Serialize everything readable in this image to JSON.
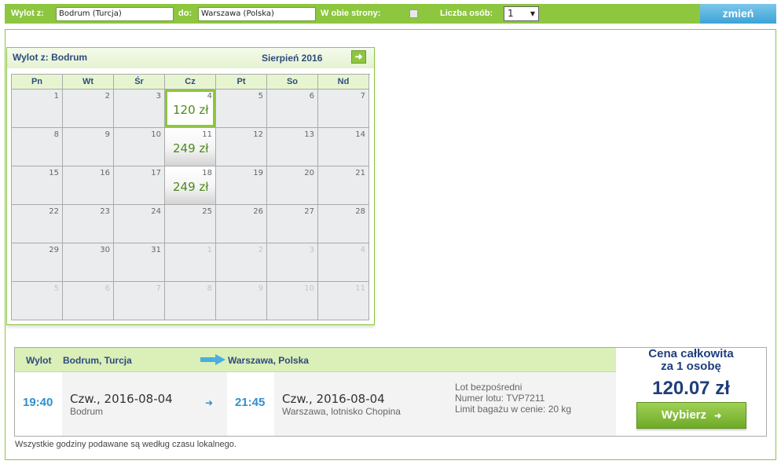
{
  "search": {
    "from_label": "Wylot z:",
    "from_value": "Bodrum (Turcja)",
    "to_label": "do:",
    "to_value": "Warszawa (Polska)",
    "roundtrip_label": "W obie strony:",
    "roundtrip_checked": false,
    "passengers_label": "Liczba osób:",
    "passengers_value": "1",
    "change_button": "zmień"
  },
  "calendar": {
    "from_title": "Wylot z: Bodrum",
    "month_title": "Sierpień 2016",
    "next_icon": "arrow-right-icon",
    "weekdays": [
      "Pn",
      "Wt",
      "Śr",
      "Cz",
      "Pt",
      "So",
      "Nd"
    ],
    "weeks": [
      [
        {
          "day": "1"
        },
        {
          "day": "2"
        },
        {
          "day": "3"
        },
        {
          "day": "4",
          "price": "120 zł",
          "selected": true
        },
        {
          "day": "5"
        },
        {
          "day": "6"
        },
        {
          "day": "7"
        }
      ],
      [
        {
          "day": "8"
        },
        {
          "day": "9"
        },
        {
          "day": "10"
        },
        {
          "day": "11",
          "price": "249 zł"
        },
        {
          "day": "12"
        },
        {
          "day": "13"
        },
        {
          "day": "14"
        }
      ],
      [
        {
          "day": "15"
        },
        {
          "day": "16"
        },
        {
          "day": "17"
        },
        {
          "day": "18",
          "price": "249 zł"
        },
        {
          "day": "19"
        },
        {
          "day": "20"
        },
        {
          "day": "21"
        }
      ],
      [
        {
          "day": "22"
        },
        {
          "day": "23"
        },
        {
          "day": "24"
        },
        {
          "day": "25"
        },
        {
          "day": "26"
        },
        {
          "day": "27"
        },
        {
          "day": "28"
        }
      ],
      [
        {
          "day": "29"
        },
        {
          "day": "30"
        },
        {
          "day": "31"
        },
        {
          "day": "1",
          "other": true
        },
        {
          "day": "2",
          "other": true
        },
        {
          "day": "3",
          "other": true
        },
        {
          "day": "4",
          "other": true
        }
      ],
      [
        {
          "day": "5",
          "other": true
        },
        {
          "day": "6",
          "other": true
        },
        {
          "day": "7",
          "other": true
        },
        {
          "day": "8",
          "other": true
        },
        {
          "day": "9",
          "other": true
        },
        {
          "day": "10",
          "other": true
        },
        {
          "day": "11",
          "other": true
        }
      ]
    ]
  },
  "flight": {
    "direction_label": "Wylot",
    "origin": "Bodrum, Turcja",
    "destination": "Warszawa, Polska",
    "departure_time": "19:40",
    "departure_date": "Czw., 2016-08-04",
    "departure_place": "Bodrum",
    "arrival_time": "21:45",
    "arrival_date": "Czw., 2016-08-04",
    "arrival_place": "Warszawa, lotnisko Chopina",
    "info": [
      "Lot bezpośredni",
      "Numer lotu: TVP7211",
      "Limit bagażu w cenie: 20 kg"
    ],
    "price_title_line1": "Cena całkowita",
    "price_title_line2": "za 1 osobę",
    "price_total": "120.07 zł",
    "choose_button": "Wybierz"
  },
  "footnote": "Wszystkie godziny podawane są według czasu lokalnego.",
  "colors": {
    "accent_green": "#8dc63f",
    "header_green_light": "#dbefb8",
    "price_green": "#4c8a1c",
    "time_blue": "#2f8fd0",
    "title_navy": "#1f3f7a",
    "button_blue": "#3ba3d6"
  }
}
